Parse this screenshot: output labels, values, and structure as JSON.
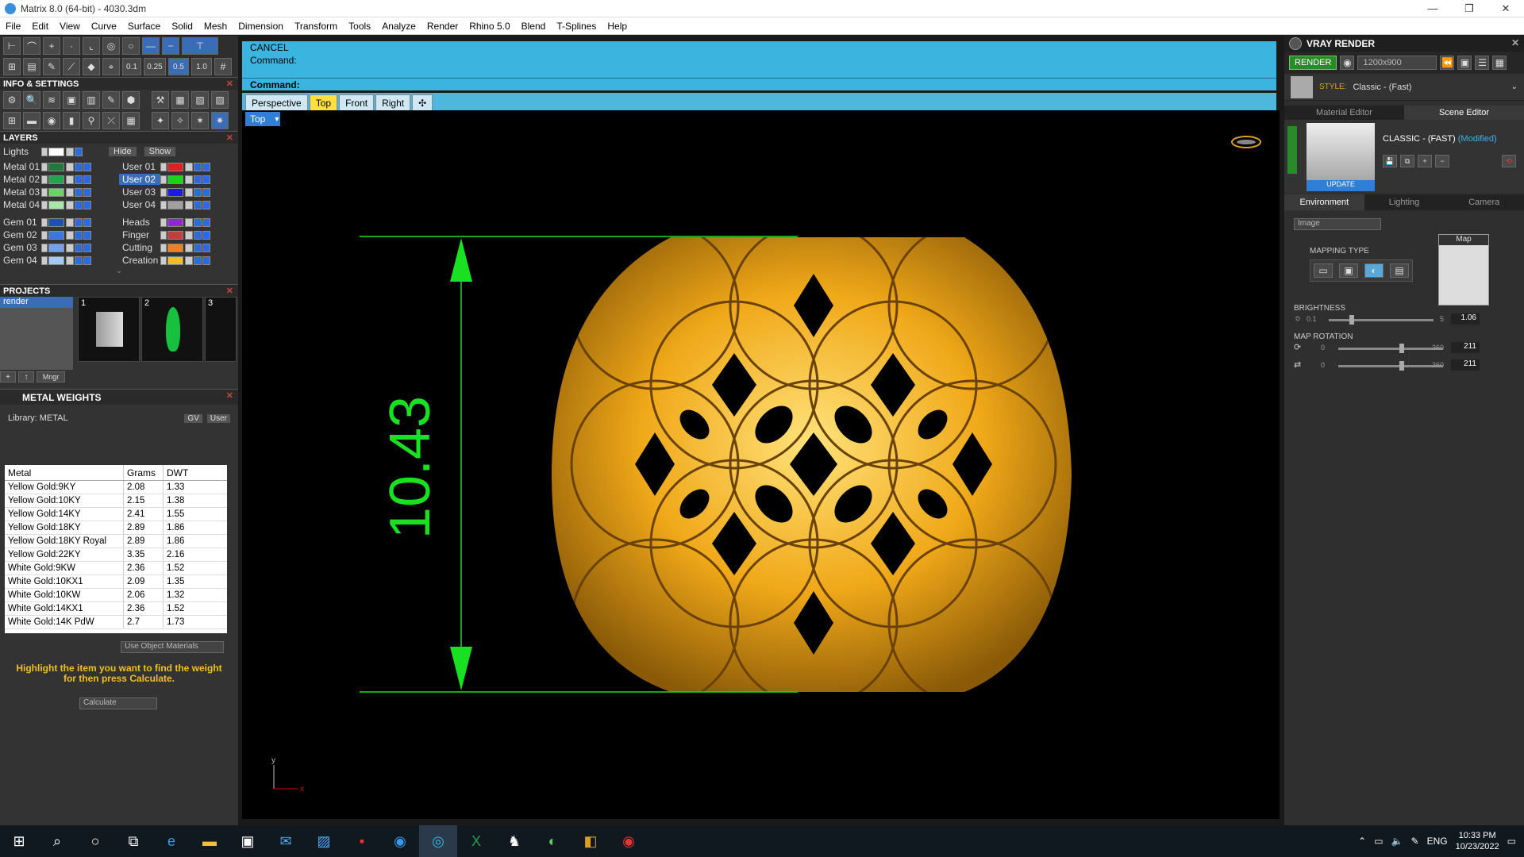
{
  "window": {
    "title": "Matrix 8.0 (64-bit) - 4030.3dm",
    "min": "—",
    "max": "❐",
    "close": "✕"
  },
  "menu": [
    "File",
    "Edit",
    "View",
    "Curve",
    "Surface",
    "Solid",
    "Mesh",
    "Dimension",
    "Transform",
    "Tools",
    "Analyze",
    "Render",
    "Rhino 5.0",
    "Blend",
    "T-Splines",
    "Help"
  ],
  "toolbar_top": {
    "values": [
      "0.1",
      "0.25",
      "0.5",
      "1.0"
    ]
  },
  "info_settings": {
    "title": "INFO & SETTINGS"
  },
  "layers": {
    "title": "LAYERS",
    "lights_label": "Lights",
    "hide_label": "Hide",
    "show_label": "Show",
    "left": [
      {
        "name": "Metal 01",
        "color": "#1e7a3c"
      },
      {
        "name": "Metal 02",
        "color": "#2aa04f"
      },
      {
        "name": "Metal 03",
        "color": "#6ad46b"
      },
      {
        "name": "Metal 04",
        "color": "#a8e6a8"
      },
      {
        "name": "Gem 01",
        "color": "#1e4fb5"
      },
      {
        "name": "Gem 02",
        "color": "#3a78e0"
      },
      {
        "name": "Gem 03",
        "color": "#6fa3f0"
      },
      {
        "name": "Gem 04",
        "color": "#a7c8f7"
      }
    ],
    "right": [
      {
        "name": "User 01",
        "color": "#e02020"
      },
      {
        "name": "User 02",
        "color": "#20d020"
      },
      {
        "name": "User 03",
        "color": "#1a1ae0"
      },
      {
        "name": "User 04",
        "color": "#a0a0a0"
      },
      {
        "name": "Heads",
        "color": "#8a2ad0"
      },
      {
        "name": "Finger",
        "color": "#c04040"
      },
      {
        "name": "Cutting",
        "color": "#f08020"
      },
      {
        "name": "Creation",
        "color": "#f0c020"
      }
    ]
  },
  "projects": {
    "title": "PROJECTS",
    "list_item": "render",
    "thumbs": [
      "1",
      "2",
      "3"
    ],
    "mngr": "Mngr"
  },
  "metal_weights": {
    "title": "METAL WEIGHTS",
    "library": "Library: METAL",
    "gv": "GV",
    "user": "User",
    "headers": [
      "Metal",
      "Grams",
      "DWT"
    ],
    "rows": [
      [
        "Yellow Gold:9KY",
        "2.08",
        "1.33"
      ],
      [
        "Yellow Gold:10KY",
        "2.15",
        "1.38"
      ],
      [
        "Yellow Gold:14KY",
        "2.41",
        "1.55"
      ],
      [
        "Yellow Gold:18KY",
        "2.89",
        "1.86"
      ],
      [
        "Yellow Gold:18KY Royal",
        "2.89",
        "1.86"
      ],
      [
        "Yellow Gold:22KY",
        "3.35",
        "2.16"
      ],
      [
        "White Gold:9KW",
        "2.36",
        "1.52"
      ],
      [
        "White Gold:10KX1",
        "2.09",
        "1.35"
      ],
      [
        "White Gold:10KW",
        "2.06",
        "1.32"
      ],
      [
        "White Gold:14KX1",
        "2.36",
        "1.52"
      ],
      [
        "White Gold:14K PdW",
        "2.7",
        "1.73"
      ]
    ],
    "use_object_materials": "Use Object Materials",
    "hint": "Highlight the item you want to find the weight for then press Calculate.",
    "calculate": "Calculate"
  },
  "command": {
    "cancel": "CANCEL",
    "line1": "Command:",
    "prompt": "Command:"
  },
  "viewtabs": [
    "Perspective",
    "Top",
    "Front",
    "Right"
  ],
  "active_viewtab": "Top",
  "viewport": {
    "label": "Top",
    "dimension": "10.43",
    "axis_y": "y",
    "axis_x": "x"
  },
  "vray": {
    "title": "VRAY RENDER",
    "render_btn": "RENDER",
    "resolution": "1200x900",
    "style_label": "STYLE:",
    "style_value": "Classic - (Fast)",
    "tabs": [
      "Material Editor",
      "Scene Editor"
    ],
    "scene_name": "CLASSIC - (FAST)",
    "modified": "(Modified)",
    "update": "UPDATE",
    "subtabs": [
      "Environment",
      "Lighting",
      "Camera"
    ],
    "env_type": "Image",
    "map_label": "Map",
    "mapping_type": "MAPPING TYPE",
    "brightness_label": "BRIGHTNESS",
    "brightness_min": "0.1",
    "brightness_max": "5",
    "brightness_value": "1.06",
    "brightness_level": 0.2,
    "map_rotation_label": "MAP ROTATION",
    "rot1_min": "0",
    "rot1_max": "360",
    "rot1_value": "211",
    "rot2_min": "0",
    "rot2_max": "360",
    "rot2_value": "211"
  },
  "taskbar": {
    "lang": "ENG",
    "time": "10:33 PM",
    "date": "10/23/2022"
  },
  "colors": {
    "command_bg": "#3bb4e0",
    "dimension": "#19e020",
    "gold": "#f2b01e"
  }
}
